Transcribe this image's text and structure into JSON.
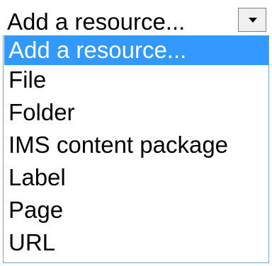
{
  "select": {
    "current_value": "Add a resource...",
    "arrow_icon": "chevron-down-icon"
  },
  "dropdown": {
    "options": [
      "Add a resource...",
      "File",
      "Folder",
      "IMS content package",
      "Label",
      "Page",
      "URL"
    ],
    "selected_index": 0,
    "highlight_color": "#3399ff",
    "highlight_text_color": "#ffffff"
  }
}
